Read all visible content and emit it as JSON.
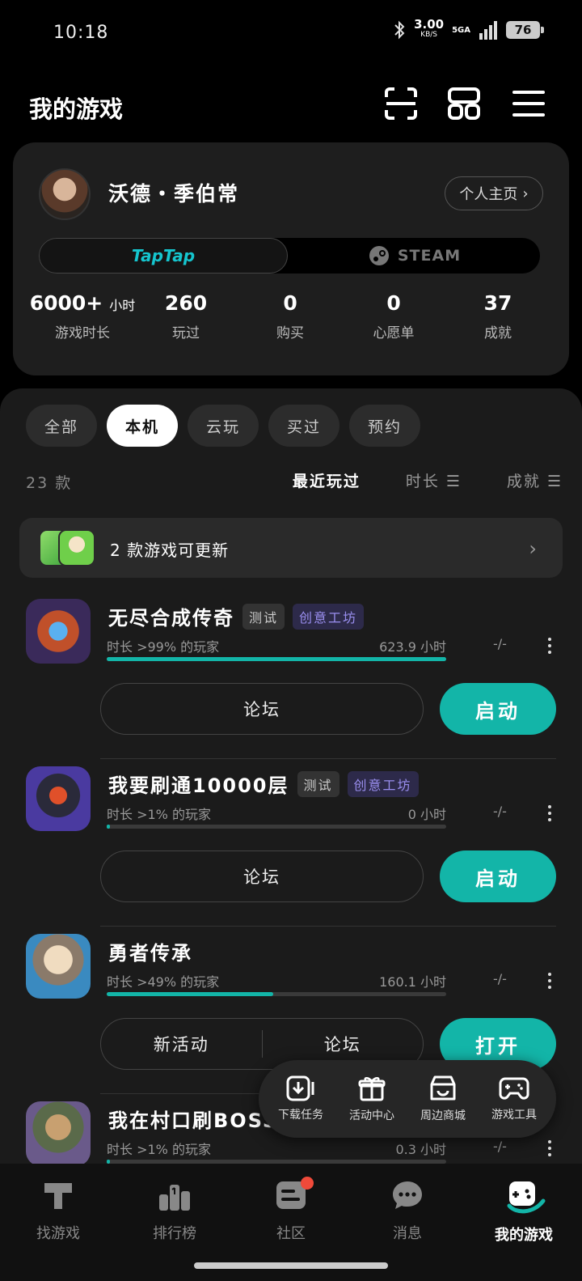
{
  "status_bar": {
    "time": "10:18",
    "net_speed": "3.00",
    "net_unit": "KB/S",
    "signal": "5GA",
    "battery": "76"
  },
  "header": {
    "title": "我的游戏"
  },
  "profile": {
    "username": "沃德・季伯常",
    "home_button": "个人主页",
    "platforms": {
      "taptap": "TapTap",
      "steam": "STEAM"
    },
    "stats": [
      {
        "value": "6000+",
        "unit": "小时",
        "label": "游戏时长"
      },
      {
        "value": "260",
        "label": "玩过"
      },
      {
        "value": "0",
        "label": "购买"
      },
      {
        "value": "0",
        "label": "心愿单"
      },
      {
        "value": "37",
        "label": "成就"
      }
    ]
  },
  "filters": {
    "tabs": [
      "全部",
      "本机",
      "云玩",
      "买过",
      "预约"
    ],
    "active": "本机"
  },
  "list": {
    "count": "23 款",
    "sort": [
      "最近玩过",
      "时长 ☰",
      "成就 ☰"
    ]
  },
  "update_banner": {
    "text": "2 款游戏可更新"
  },
  "games": [
    {
      "name": "无尽合成传奇",
      "tags": [
        "测试",
        "创意工坊"
      ],
      "percentile": "时长 >99% 的玩家",
      "hours": "623.9 小时",
      "progress": 1.0,
      "achievement": "-/-",
      "buttons": [
        "论坛"
      ],
      "action": "启动"
    },
    {
      "name": "我要刷通10000层",
      "tags": [
        "测试",
        "创意工坊"
      ],
      "percentile": "时长 >1% 的玩家",
      "hours": "0 小时",
      "progress": 0.01,
      "achievement": "-/-",
      "buttons": [
        "论坛"
      ],
      "action": "启动"
    },
    {
      "name": "勇者传承",
      "tags": [],
      "percentile": "时长 >49% 的玩家",
      "hours": "160.1 小时",
      "progress": 0.49,
      "achievement": "-/-",
      "buttons": [
        "新活动",
        "论坛"
      ],
      "action": "打开"
    },
    {
      "name": "我在村口刷BOSS",
      "tags": [],
      "percentile": "时长 >1% 的玩家",
      "hours": "0.3 小时",
      "progress": 0.01,
      "achievement": "-/-",
      "buttons": [],
      "action": ""
    }
  ],
  "floating_menu": [
    "下载任务",
    "活动中心",
    "周边商城",
    "游戏工具"
  ],
  "bottom_nav": [
    {
      "label": "找游戏",
      "icon": "taptap-icon"
    },
    {
      "label": "排行榜",
      "icon": "ranking-icon"
    },
    {
      "label": "社区",
      "icon": "community-icon"
    },
    {
      "label": "消息",
      "icon": "message-icon"
    },
    {
      "label": "我的游戏",
      "icon": "gamepad-icon",
      "active": true
    }
  ],
  "colors": {
    "accent": "#13b5a8",
    "taptap": "#15c5ce",
    "workshop": "#9a8ff0",
    "badge": "#f04a3a"
  }
}
